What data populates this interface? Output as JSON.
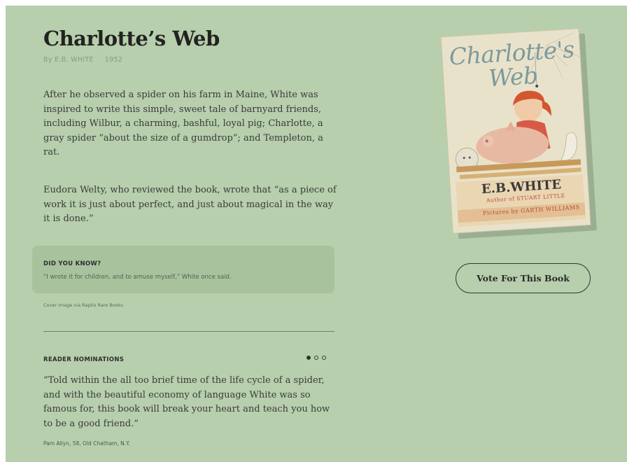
{
  "book": {
    "title": "Charlotte’s Web",
    "byline": "By E.B. WHITE",
    "year": "1952"
  },
  "description": [
    "After he observed a spider on his farm in Maine, White was inspired to write this simple, sweet tale of barnyard friends, including Wilbur, a charming, bashful, loyal pig; Charlotte, a gray spider “about the size of a gumdrop”; and Templeton, a rat.",
    "Eudora Welty, who reviewed the book, wrote that “as a piece of work it is just about perfect, and just about magical in the way it is done.”"
  ],
  "did_you_know": {
    "heading": "DID YOU KNOW?",
    "text": "“I wrote it for children, and to amuse myself,” White once said."
  },
  "cover_credit": "Cover image via Raptis Rare Books",
  "cover": {
    "title": "Charlotte's Web",
    "author": "E.B.WHITE",
    "other_books": "Author of STUART LITTLE",
    "illustrator": "Pictures by GARTH WILLIAMS"
  },
  "nominations": {
    "heading": "READER NOMINATIONS",
    "current_slide": 1,
    "total_slides": 3,
    "quote": "“Told within the all too brief time of the life cycle of a spider, and with the beautiful economy of language White was so famous for, this book will break your heart and teach you how to be a good friend.”",
    "nominator": "Pam Allyn, 58, Old Chatham, N.Y."
  },
  "vote_button": "Vote For This Book",
  "colors": {
    "background": "#b7cfac",
    "callout": "#a9c29e",
    "text": "#2b2b2b"
  }
}
